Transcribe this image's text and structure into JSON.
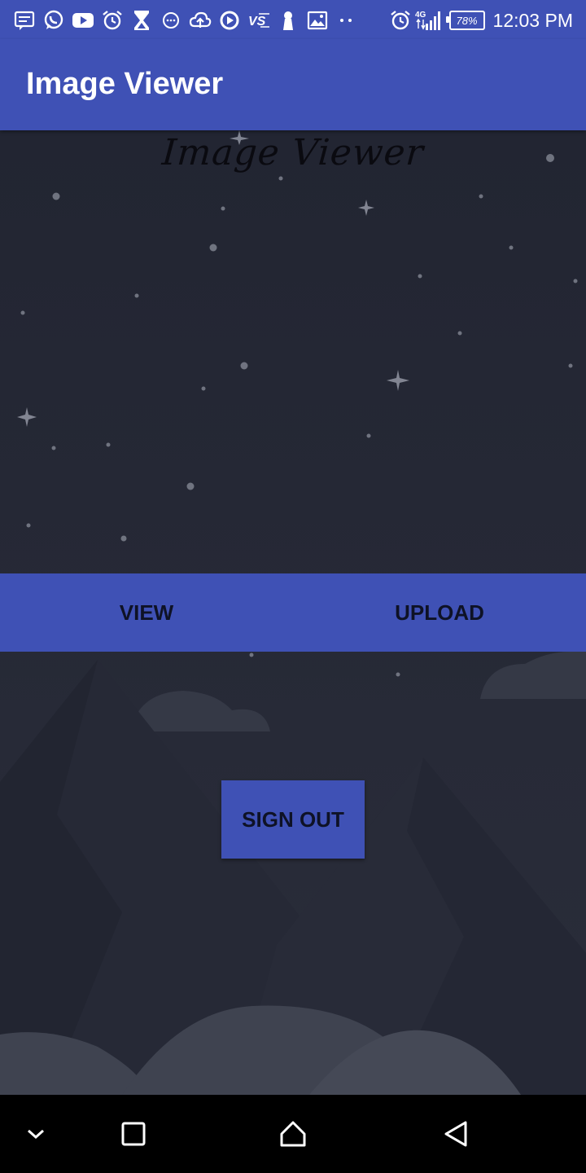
{
  "status_bar": {
    "left_icons": [
      "message-icon",
      "whatsapp-icon",
      "youtube-icon",
      "alarm-icon",
      "hourglass-icon",
      "chat-bubble-icon",
      "cloud-upload-icon",
      "play-icon",
      "vs-icon",
      "keyhole-icon",
      "image-icon",
      "more-dots-icon"
    ],
    "alarm_icon": "alarm-icon",
    "network_label": "4G",
    "battery": "78%",
    "time": "12:03 PM"
  },
  "app_bar": {
    "title": "Image Viewer",
    "color": "#3f51b5"
  },
  "main": {
    "logo_text": "Image Viewer",
    "tabs": [
      {
        "label": "VIEW"
      },
      {
        "label": "UPLOAD"
      }
    ],
    "sign_out_label": "SIGN OUT"
  },
  "nav_bar": {
    "buttons": [
      "chevron-down-icon",
      "recents-icon",
      "home-icon",
      "back-icon"
    ]
  },
  "colors": {
    "primary": "#3f51b5",
    "background": "#232633",
    "button_text": "#0e1226"
  }
}
